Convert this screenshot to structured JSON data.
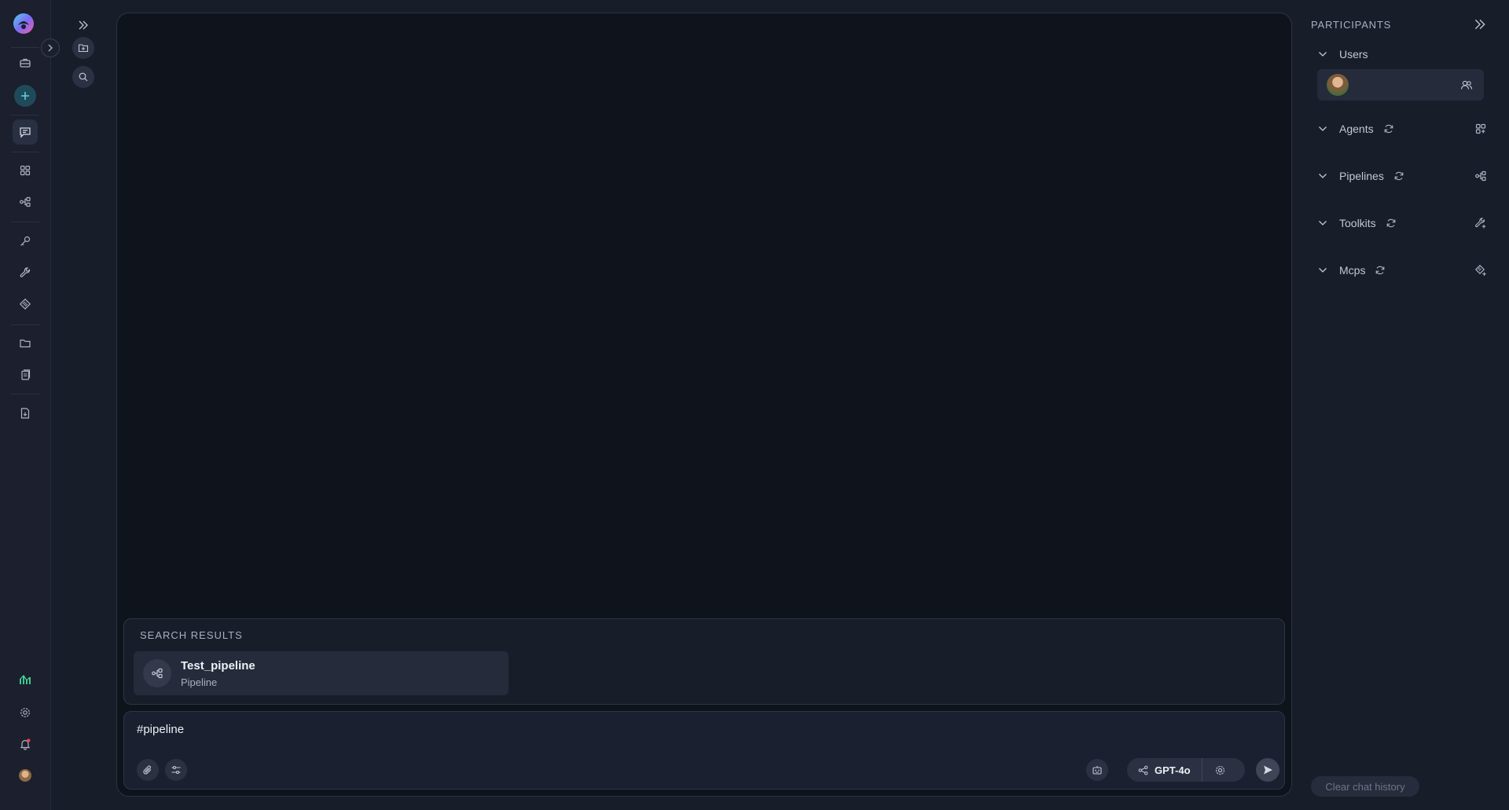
{
  "app": {
    "logo_icon": "app-logo"
  },
  "rail": {
    "items": [
      {
        "name": "briefcase-icon"
      },
      {
        "name": "plus-icon"
      },
      {
        "name": "chat-icon"
      },
      {
        "name": "grid-icon"
      },
      {
        "name": "pipeline-icon"
      },
      {
        "name": "key-icon"
      },
      {
        "name": "wrench-icon"
      },
      {
        "name": "mcp-icon"
      },
      {
        "name": "folder-icon"
      },
      {
        "name": "files-icon"
      },
      {
        "name": "document-icon"
      },
      {
        "name": "monitoring-icon"
      },
      {
        "name": "gear-icon"
      },
      {
        "name": "bell-icon"
      },
      {
        "name": "avatar"
      }
    ]
  },
  "search_results": {
    "title": "SEARCH RESULTS",
    "items": [
      {
        "name": "Test_pipeline",
        "type": "Pipeline",
        "icon": "pipeline-icon"
      }
    ]
  },
  "composer": {
    "value": "#pipeline",
    "model": "GPT-4o"
  },
  "participants": {
    "title": "PARTICIPANTS",
    "sections": [
      {
        "label": "Users"
      },
      {
        "label": "Agents"
      },
      {
        "label": "Pipelines"
      },
      {
        "label": "Toolkits"
      },
      {
        "label": "Mcps"
      }
    ],
    "clear_label": "Clear chat history"
  },
  "colors": {
    "background": "#181d2a",
    "panel": "#0f131c",
    "accent": "#1f4a5a",
    "notification": "#e5484d",
    "monitoring": "#3ddc97"
  }
}
